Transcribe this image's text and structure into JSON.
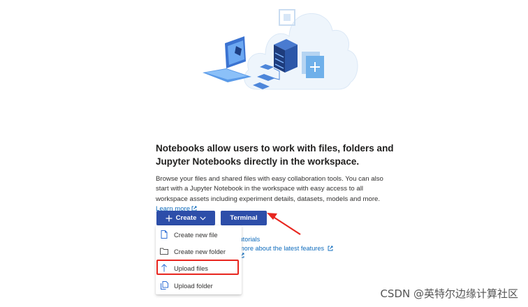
{
  "page": {
    "heading": "Notebooks allow users to work with files, folders and Jupyter Notebooks directly in the workspace.",
    "description": "Browse your files and shared files with easy collaboration tools. You can also start with a Jupyter Notebook in the workspace with easy access to all workspace assets including experiment details, datasets, models and more.",
    "learn_more": "Learn more"
  },
  "buttons": {
    "create": "Create",
    "terminal": "Terminal"
  },
  "create_menu": {
    "items": [
      {
        "label": "Create new file",
        "icon": "file-icon"
      },
      {
        "label": "Create new folder",
        "icon": "folder-icon"
      },
      {
        "label": "Upload files",
        "icon": "upload-icon"
      },
      {
        "label": "Upload folder",
        "icon": "copy-folder-icon"
      }
    ]
  },
  "background_links": {
    "tutorials": "tutorials",
    "latest": "more about the latest features"
  },
  "watermark": "CSDN @英特尔边缘计算社区",
  "colors": {
    "primary": "#2d4ea9",
    "link": "#0f6cbd",
    "annotation_red": "#e8261f"
  }
}
